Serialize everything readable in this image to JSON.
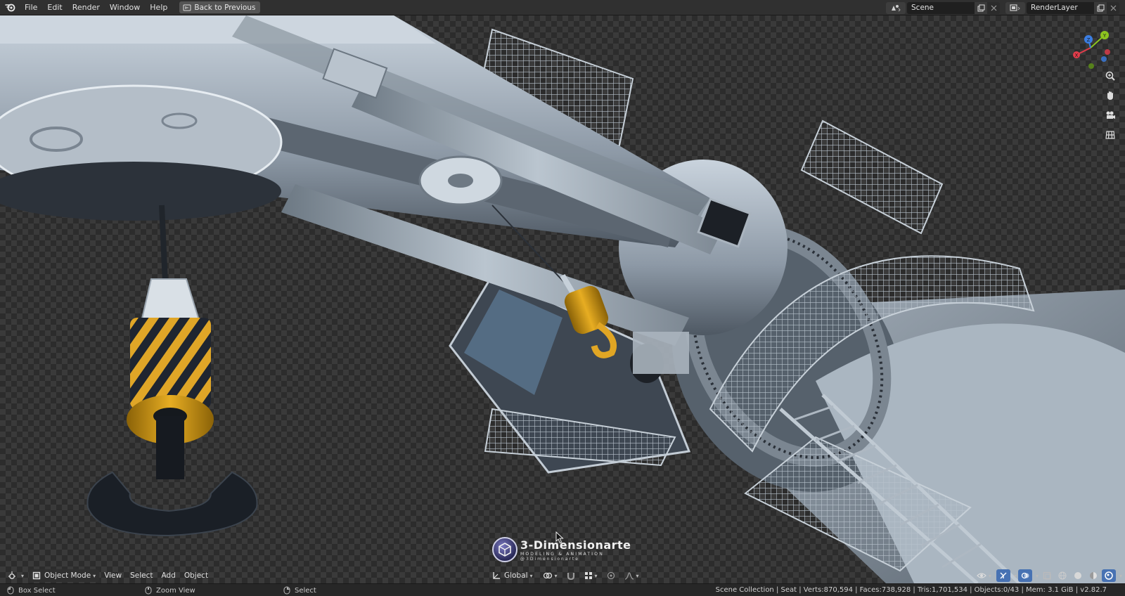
{
  "menu": {
    "file": "File",
    "edit": "Edit",
    "render": "Render",
    "window": "Window",
    "help": "Help"
  },
  "back_button": "Back to Previous",
  "scene": {
    "name": "Scene"
  },
  "view_layer": {
    "name": "RenderLayer"
  },
  "gizmo": {
    "x": "X",
    "y": "Y",
    "z": "Z"
  },
  "viewport_header": {
    "mode": "Object Mode",
    "view": "View",
    "select": "Select",
    "add": "Add",
    "object": "Object",
    "orientation": "Global"
  },
  "watermark": {
    "title": "3-Dimensionarte",
    "subtitle": "MODELING & ANIMATION",
    "handle": "@3Dimensionarte"
  },
  "statusbar": {
    "left_action": "Box Select",
    "middle_action": "Zoom View",
    "right_action": "Select",
    "stats": "Scene Collection | Seat | Verts:870,594 | Faces:738,928 | Tris:1,701,534 | Objects:0/43 | Mem: 3.1 GiB | v2.82.7"
  },
  "colors": {
    "accent": "#4772b3",
    "topbar": "#303030",
    "statusbar": "#272727",
    "axis_x": "#e23c4b",
    "axis_y": "#8cc41f",
    "axis_z": "#3b7ee3"
  },
  "icons": {
    "app": "blender-logo-icon",
    "back": "back-screen-icon",
    "scene_type": "scene-icon",
    "layer_type": "render-layer-icon",
    "zoom": "zoom-icon",
    "pan": "hand-icon",
    "camera": "camera-icon",
    "ortho": "grid-icon"
  }
}
